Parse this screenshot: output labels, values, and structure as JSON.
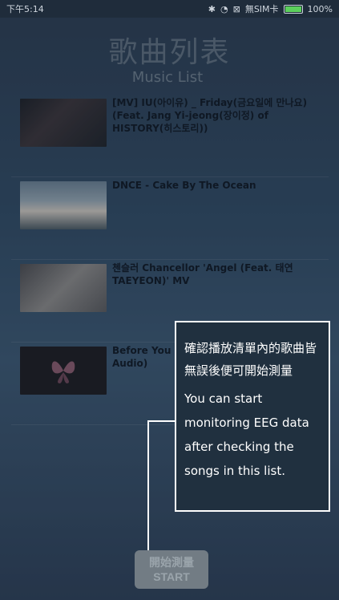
{
  "statusbar": {
    "time": "下午5:14",
    "carrier": "無SIM卡",
    "battery": "100%",
    "icons": [
      "bluetooth-icon",
      "wifi-icon",
      "sim-icon",
      "battery-icon"
    ]
  },
  "header": {
    "title_zh": "歌曲列表",
    "title_en": "Music List"
  },
  "songs": [
    {
      "title": "[MV] IU(아이유) _ Friday(금요일에 만나요)(Feat. Jang Yi-jeong(장이정) of HISTORY(히스토리))"
    },
    {
      "title": "DNCE - Cake By The Ocean"
    },
    {
      "title": "첸슬러 Chancellor 'Angel (Feat. 태연 TAEYEON)' MV"
    },
    {
      "title": "Before You Exit - Clouds (Official Audio)"
    }
  ],
  "tooltip": {
    "text_zh": "確認播放清單內的歌曲皆無誤後便可開始測量",
    "text_en": "You can start monitoring EEG data after checking the songs in this list."
  },
  "start_button": {
    "label_zh": "開始測量",
    "label_en": "START"
  }
}
